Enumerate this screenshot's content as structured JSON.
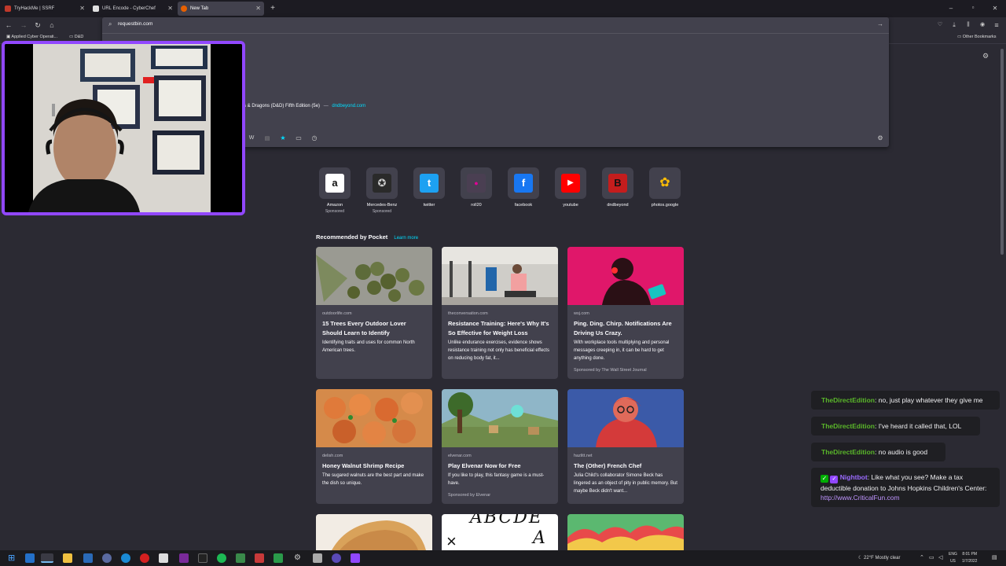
{
  "tabs": [
    {
      "label": "TryHackMe | SSRF",
      "color": "#c0392b"
    },
    {
      "label": "URL Encode - CyberChef",
      "color": "#e0e0e0"
    },
    {
      "label": "New Tab",
      "color": "#e66000"
    }
  ],
  "address_bar": {
    "value": "requestbin.com"
  },
  "bookmarks": {
    "items": [
      "Applied Cyber Operati...",
      "D&D",
      "Other Bookmarks"
    ]
  },
  "url_panel": {
    "suggestion_text": "s & Dragons (D&D) Fifth Edition (5e)",
    "suggestion_sep": "—",
    "suggestion_domain": "dndbeyond.com"
  },
  "top_sites": [
    {
      "label": "Amazon",
      "sub": "Sponsored",
      "glyph": "a",
      "bg": "#ffffff",
      "fg": "#111111"
    },
    {
      "label": "Mercedes-Benz",
      "sub": "Sponsored",
      "glyph": "✪",
      "bg": "#2a2a2a",
      "fg": "#cccccc"
    },
    {
      "label": "twitter",
      "sub": "",
      "glyph": "t",
      "bg": "#1da1f2",
      "fg": "#ffffff"
    },
    {
      "label": "roll20",
      "sub": "",
      "glyph": "●",
      "bg": "#4a3f52",
      "fg": "#e10097"
    },
    {
      "label": "facebook",
      "sub": "",
      "glyph": "f",
      "bg": "#1877f2",
      "fg": "#ffffff"
    },
    {
      "label": "youtube",
      "sub": "",
      "glyph": "▶",
      "bg": "#ff0000",
      "fg": "#ffffff"
    },
    {
      "label": "dndbeyond",
      "sub": "",
      "glyph": "B",
      "bg": "#c41d1d",
      "fg": "#111111"
    },
    {
      "label": "photos.google",
      "sub": "",
      "glyph": "✿",
      "bg": "#42414d",
      "fg": "#fbbc05"
    }
  ],
  "pocket": {
    "heading": "Recommended by Pocket",
    "learn_more": "Learn more"
  },
  "cards": [
    {
      "source": "outdoorlife.com",
      "title": "15 Trees Every Outdoor Lover Should Learn to Identify",
      "excerpt": "Identifying traits and uses for common North American trees.",
      "sponsor": ""
    },
    {
      "source": "theconversation.com",
      "title": "Resistance Training: Here's Why It's So Effective for Weight Loss",
      "excerpt": "Unlike endurance exercises, evidence shows resistance training not only has beneficial effects on reducing body fat, it...",
      "sponsor": ""
    },
    {
      "source": "wsj.com",
      "title": "Ping. Ding. Chirp. Notifications Are Driving Us Crazy.",
      "excerpt": "With workplace tools multiplying and personal messages creeping in, it can be hard to get anything done.",
      "sponsor": "Sponsored by The Wall Street Journal"
    },
    {
      "source": "delish.com",
      "title": "Honey Walnut Shrimp Recipe",
      "excerpt": "The sugared walnuts are the best part and make the dish so unique.",
      "sponsor": ""
    },
    {
      "source": "elvenar.com",
      "title": "Play Elvenar Now for Free",
      "excerpt": "If you like to play, this fantasy game is a must-have.",
      "sponsor": "Sponsored by Elvenar"
    },
    {
      "source": "hazlitt.net",
      "title": "The (Other) French Chef",
      "excerpt": "Julia Child's collaborator Simone Beck has lingered as an object of pity in public memory. But maybe Beck didn't want...",
      "sponsor": ""
    }
  ],
  "card_peek": {
    "letters": "ABCDE",
    "x": "×",
    "a": "A"
  },
  "chat": [
    {
      "user": "TheDirectEdition",
      "text": ": no, just play whatever they give me"
    },
    {
      "user": "TheDirectEdition",
      "text": ": I've heard it called that, LOL"
    },
    {
      "user": "TheDirectEdition",
      "text": ": no audio is good"
    },
    {
      "user": "Nightbot",
      "text": ": Like what you see? Make a tax deductible donation to Johns Hopkins Children's Center: ",
      "link": "http://www.CriticalFun.com"
    }
  ],
  "taskbar": {
    "weather": "22°F  Mostly clear",
    "lang": "ENG",
    "region": "US",
    "time": "8:01 PM",
    "date": "1/7/2022"
  }
}
